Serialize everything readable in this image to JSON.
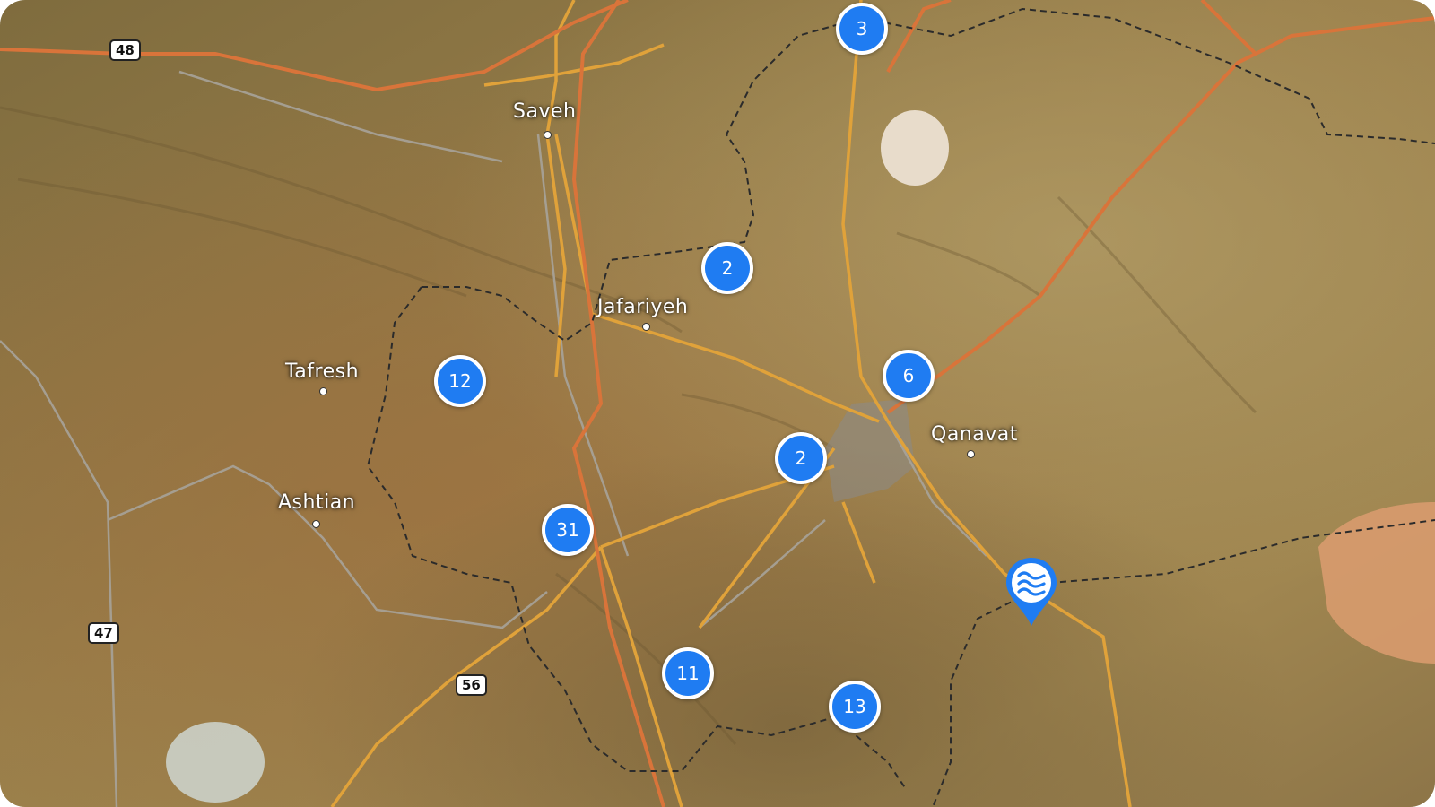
{
  "map": {
    "places": [
      {
        "name": "Saveh"
      },
      {
        "name": "Jafariyeh"
      },
      {
        "name": "Tafresh"
      },
      {
        "name": "Ashtian"
      },
      {
        "name": "Qanavat"
      }
    ],
    "road_shields": [
      "48",
      "47",
      "56"
    ],
    "clusters": [
      {
        "count": "3"
      },
      {
        "count": "2"
      },
      {
        "count": "12"
      },
      {
        "count": "6"
      },
      {
        "count": "2"
      },
      {
        "count": "31"
      },
      {
        "count": "11"
      },
      {
        "count": "13"
      }
    ],
    "marker": {
      "icon": "water-waves-icon"
    },
    "colors": {
      "cluster": "#1f7cf2",
      "cluster_border": "#ffffff",
      "road_major": "#e0a23a",
      "road_highway": "#d9743a",
      "border": "#2b2b2b"
    }
  }
}
